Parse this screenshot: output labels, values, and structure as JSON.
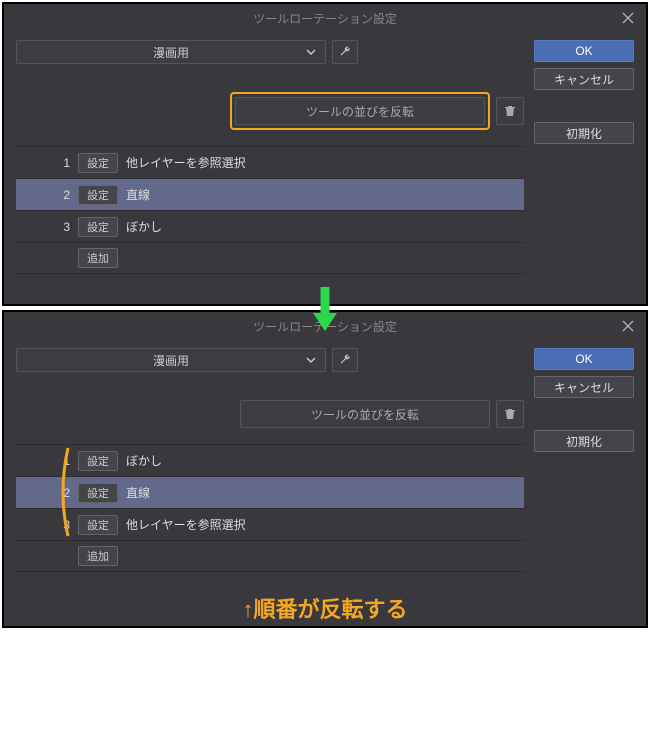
{
  "dialog1": {
    "title": "ツールローテーション設定",
    "dropdown": "漫画用",
    "reverse_label": "ツールの並びを反転",
    "rows": [
      {
        "num": "1",
        "btn": "設定",
        "label": "他レイヤーを参照選択"
      },
      {
        "num": "2",
        "btn": "設定",
        "label": "直線"
      },
      {
        "num": "3",
        "btn": "設定",
        "label": "ぼかし"
      }
    ],
    "add_label": "追加",
    "ok": "OK",
    "cancel": "キャンセル",
    "reset": "初期化"
  },
  "dialog2": {
    "title": "ツールローテーション設定",
    "dropdown": "漫画用",
    "reverse_label": "ツールの並びを反転",
    "rows": [
      {
        "num": "1",
        "btn": "設定",
        "label": "ぼかし"
      },
      {
        "num": "2",
        "btn": "設定",
        "label": "直線"
      },
      {
        "num": "3",
        "btn": "設定",
        "label": "他レイヤーを参照選択"
      }
    ],
    "add_label": "追加",
    "ok": "OK",
    "cancel": "キャンセル",
    "reset": "初期化"
  },
  "caption": "↑順番が反転する",
  "colors": {
    "highlight": "#f5a623",
    "arrow": "#2bd84b"
  }
}
